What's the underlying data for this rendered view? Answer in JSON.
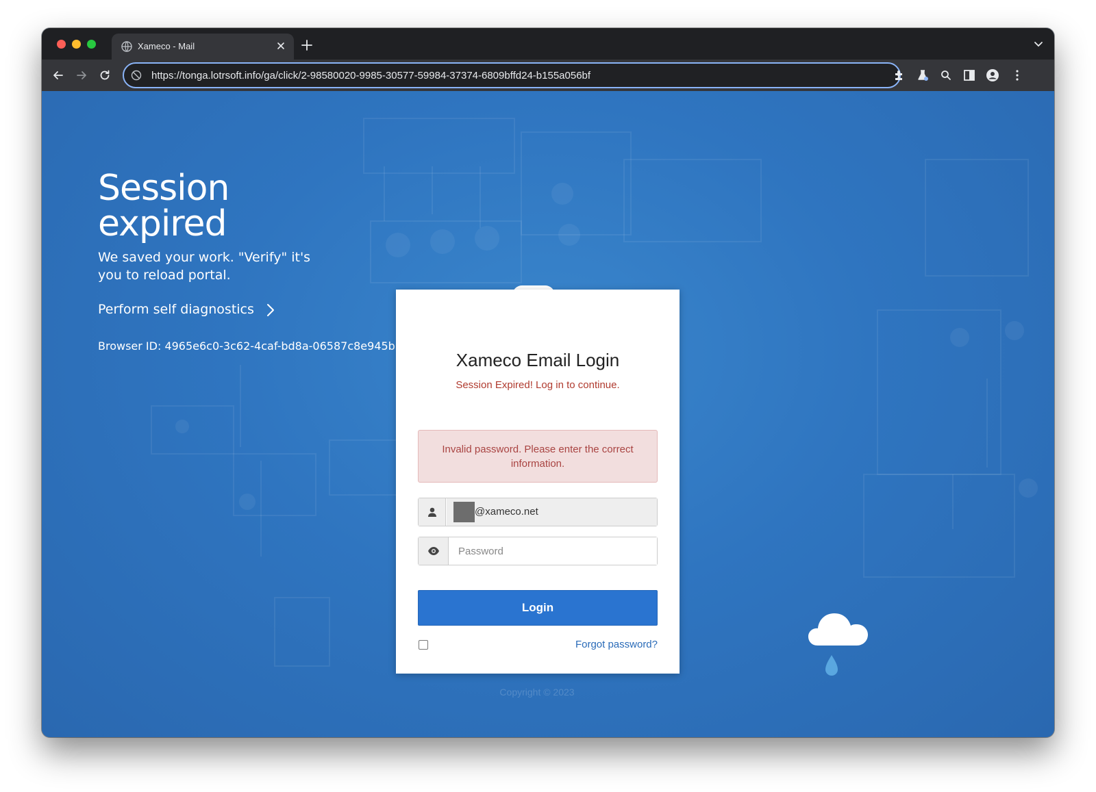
{
  "browser": {
    "tab_title": "Xameco - Mail",
    "url": "https://tonga.lotrsoft.info/ga/click/2-98580020-9985-30577-59984-37374-6809bffd24-b155a056bf"
  },
  "hero": {
    "headline": "Session expired",
    "subtext": "We saved your work. \"Verify\" it's you to reload portal.",
    "diagnostics_link": "Perform self diagnostics",
    "browser_id": "Browser ID: 4965e6c0-3c62-4caf-bd8a-06587c8e945b"
  },
  "login": {
    "title": "Xameco Email Login",
    "subtitle": "Session Expired! Log in to continue.",
    "error_message": "Invalid password. Please enter the correct information.",
    "email_value": "@xameco.net",
    "password_placeholder": "Password",
    "login_label": "Login",
    "forgot_label": "Forgot password?",
    "remember_checked": false
  },
  "footer": {
    "copyright": "Copyright © 2023"
  },
  "colors": {
    "page_background": "#2f75c0",
    "login_button": "#2a74d0",
    "error_text": "#a94442",
    "error_background": "#f2dede"
  },
  "icons": [
    "globe-icon",
    "close-icon",
    "plus-icon",
    "chevron-down-icon",
    "back-arrow-icon",
    "forward-arrow-icon",
    "reload-icon",
    "site-info-icon",
    "extensions-icon",
    "labs-icon",
    "search-icon",
    "side-panel-icon",
    "profile-icon",
    "kebab-menu-icon",
    "chevron-right-icon",
    "user-icon",
    "eye-icon",
    "cloud-icon"
  ]
}
